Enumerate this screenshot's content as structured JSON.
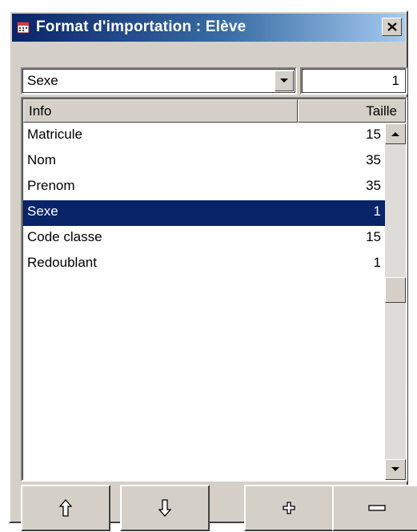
{
  "window": {
    "title": "Format d'importation : Elève",
    "title_icon": "calendar-icon",
    "close_icon": "close-icon"
  },
  "field_select": {
    "value": "Sexe",
    "dropdown_icon": "chevron-down-icon"
  },
  "size_field": {
    "value": "1"
  },
  "table": {
    "columns": [
      "Info",
      "Taille"
    ],
    "rows": [
      {
        "info": "Matricule",
        "taille": "15"
      },
      {
        "info": "Nom",
        "taille": "35"
      },
      {
        "info": "Prenom",
        "taille": "35"
      },
      {
        "info": "Sexe",
        "taille": "1"
      },
      {
        "info": "Code classe",
        "taille": "15"
      },
      {
        "info": "Redoublant",
        "taille": "1"
      }
    ],
    "selected_row": "Sexe"
  },
  "buttons": {
    "move_up_icon": "arrow-up-icon",
    "move_down_icon": "arrow-down-icon",
    "add_icon": "plus-icon",
    "remove_icon": "minus-icon"
  },
  "colors": {
    "selection": "#0a246a",
    "titlebar_start": "#0a246a",
    "titlebar_end": "#a6caf0",
    "face": "#d4d0c8"
  }
}
